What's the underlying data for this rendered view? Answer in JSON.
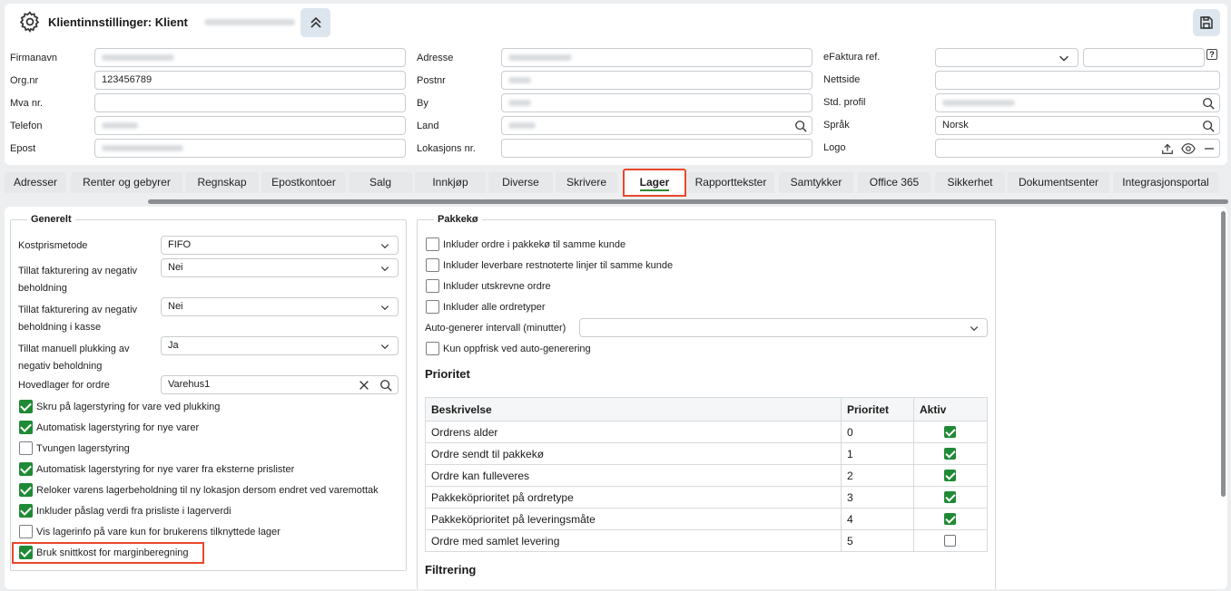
{
  "header": {
    "title": "Klientinnstillinger: Klient"
  },
  "fields": {
    "firmanavn": "Firmanavn",
    "orgnr_label": "Org.nr",
    "orgnr_value": "123456789",
    "mva": "Mva nr.",
    "telefon": "Telefon",
    "epost": "Epost",
    "adresse": "Adresse",
    "postnr": "Postnr",
    "by": "By",
    "land": "Land",
    "lokasjon": "Lokasjons nr.",
    "efaktura": "eFaktura ref.",
    "nettside": "Nettside",
    "std_profil": "Std. profil",
    "sprak_label": "Språk",
    "sprak_value": "Norsk",
    "logo": "Logo"
  },
  "tabs": [
    "Adresser",
    "Renter og gebyrer",
    "Regnskap",
    "Epostkontoer",
    "Salg",
    "Innkjøp",
    "Diverse",
    "Skrivere",
    "Lager",
    "Rapporttekster",
    "Samtykker",
    "Office 365",
    "Sikkerhet",
    "Dokumentsenter",
    "Integrasjonsportal"
  ],
  "generelt": {
    "legend": "Generelt",
    "kostprismetode_label": "Kostprismetode",
    "kostprismetode_value": "FIFO",
    "neg_beh_label1": "Tillat fakturering av negativ",
    "neg_beh_label2": "beholdning",
    "neg_beh_value": "Nei",
    "neg_kasse_label1": "Tillat fakturering av negativ",
    "neg_kasse_label2": "beholdning i kasse",
    "neg_kasse_value": "Nei",
    "manuell_label1": "Tillat manuell plukking av",
    "manuell_label2": "negativ beholdning",
    "manuell_value": "Ja",
    "hovedlager_label": "Hovedlager for ordre",
    "hovedlager_value": "Varehus1",
    "checks": [
      {
        "label": "Skru på lagerstyring for vare ved plukking",
        "checked": true
      },
      {
        "label": "Automatisk lagerstyring for nye varer",
        "checked": true
      },
      {
        "label": "Tvungen lagerstyring",
        "checked": false
      },
      {
        "label": "Automatisk lagerstyring for nye varer fra eksterne prislister",
        "checked": true
      },
      {
        "label": "Reloker varens lagerbeholdning til ny lokasjon dersom endret ved varemottak",
        "checked": true
      },
      {
        "label": "Inkluder påslag verdi fra prisliste i lagerverdi",
        "checked": true
      },
      {
        "label": "Vis lagerinfo på vare kun for brukerens tilknyttede lager",
        "checked": false
      },
      {
        "label": "Bruk snittkost for marginberegning",
        "checked": true
      }
    ]
  },
  "pakkeko": {
    "legend": "Pakkekø",
    "checks": [
      {
        "label": "Inkluder ordre i pakkekø til samme kunde",
        "checked": false
      },
      {
        "label": "Inkluder leverbare restnoterte linjer til samme kunde",
        "checked": false
      },
      {
        "label": "Inkluder utskrevne ordre",
        "checked": false
      },
      {
        "label": "Inkluder alle ordretyper",
        "checked": false
      }
    ],
    "auto_label": "Auto-generer intervall (minutter)",
    "kun_oppfrisk": "Kun oppfrisk ved auto-generering",
    "prioritet_heading": "Prioritet",
    "filtrering_heading": "Filtrering",
    "table_headers": [
      "Beskrivelse",
      "Prioritet",
      "Aktiv"
    ],
    "rows": [
      {
        "desc": "Ordrens alder",
        "pri": "0",
        "active": true
      },
      {
        "desc": "Ordre sendt til pakkekø",
        "pri": "1",
        "active": true
      },
      {
        "desc": "Ordre kan fulleveres",
        "pri": "2",
        "active": true
      },
      {
        "desc": "Pakkeköprioritet på ordretype",
        "pri": "3",
        "active": true
      },
      {
        "desc": "Pakkeköprioritet på leveringsmåte",
        "pri": "4",
        "active": true
      },
      {
        "desc": "Ordre med samlet levering",
        "pri": "5",
        "active": false
      }
    ]
  },
  "colors": {
    "accent": "#e8472b",
    "check": "#1f8a35"
  }
}
